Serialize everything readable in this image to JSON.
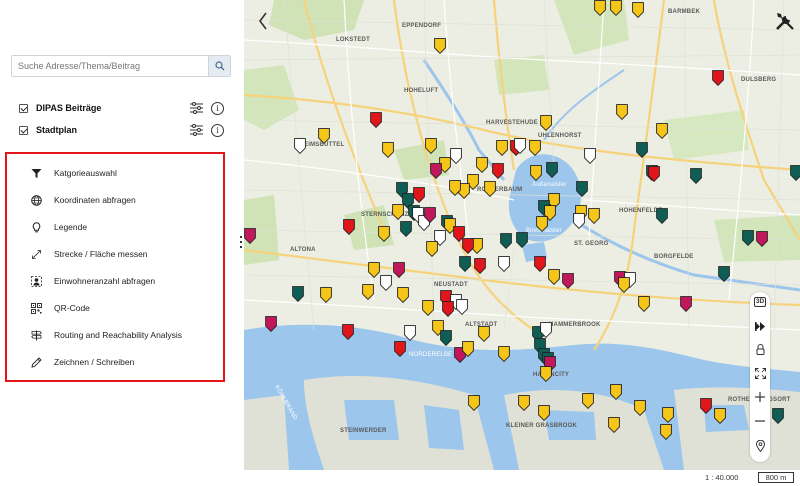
{
  "sidebar": {
    "search": {
      "placeholder": "Suche Adresse/Thema/Beitrag",
      "value": ""
    },
    "layers": [
      {
        "label": "DIPAS Beiträge",
        "checked": true
      },
      {
        "label": "Stadtplan",
        "checked": true
      }
    ],
    "tools": [
      {
        "label": "Katgorieauswahl",
        "icon": "filter-icon"
      },
      {
        "label": "Koordinaten abfragen",
        "icon": "globe-icon"
      },
      {
        "label": "Legende",
        "icon": "lightbulb-icon"
      },
      {
        "label": "Strecke / Fläche messen",
        "icon": "measure-arrows-icon"
      },
      {
        "label": "Einwohneranzahl abfragen",
        "icon": "population-icon"
      },
      {
        "label": "QR-Code",
        "icon": "qr-code-icon"
      },
      {
        "label": "Routing and Reachability Analysis",
        "icon": "signpost-icon"
      },
      {
        "label": "Zeichnen / Schreiben",
        "icon": "pencil-icon"
      }
    ],
    "highlight_color": "#e0161a"
  },
  "map": {
    "labels": [
      "LOKSTEDT",
      "EPPENDORF",
      "BARMBEK",
      "DULSBERG",
      "HOHELUFT",
      "HARVESTEHUDE",
      "UHLENHORST",
      "EIMSBÜTTEL",
      "ROTHERBAUM",
      "Außenalster",
      "HOHENFELDE",
      "STERNSCHANZE",
      "Binnenalster",
      "ST. GEORG",
      "BORGFELDE",
      "ALTONA",
      "NEUSTADT",
      "ALTSTADT",
      "HAMMERBROOK",
      "NORDERELBE",
      "HAFENCITY",
      "KÖHLBRAND",
      "STEINWERDER",
      "KLEINER GRASBROOK",
      "ROTHENBURGSORT"
    ],
    "marker_colors": {
      "yellow": "#f5c518",
      "white": "#ffffff",
      "teal": "#0f5e55",
      "red": "#e0161a",
      "magenta": "#c2185b"
    },
    "controls": [
      "3D",
      "compass",
      "lock",
      "fullscreen",
      "zoom-in",
      "zoom-out",
      "locate"
    ],
    "scale": {
      "ratio": "1 : 40.000",
      "bar": "800 m"
    }
  }
}
